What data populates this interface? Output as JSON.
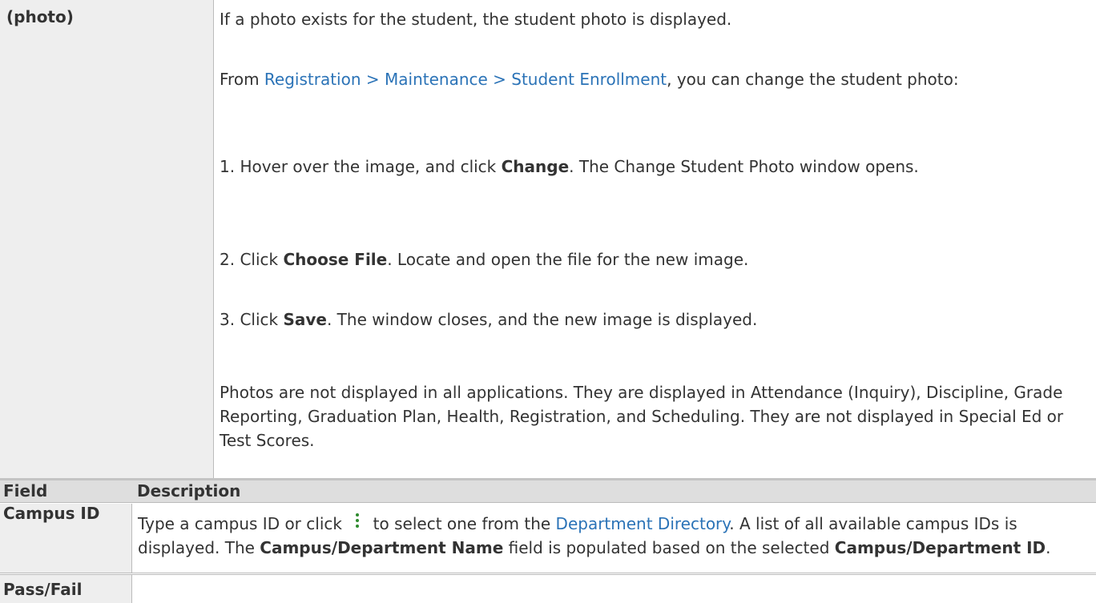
{
  "top_table": {
    "label": "(photo)",
    "p1": "If a photo exists for the student, the student photo is displayed.",
    "p2_pre": "From ",
    "p2_link": "Registration > Maintenance > Student Enrollment",
    "p2_post": ", you can change the student photo:",
    "step1_pre": "1. Hover over the image, and click ",
    "step1_bold": "Change",
    "step1_post": ". The Change Student Photo window opens.",
    "step2_pre": "2. Click ",
    "step2_bold": "Choose File",
    "step2_post": ". Locate and open the file for the new image.",
    "step3_pre": "3. Click ",
    "step3_bold": "Save",
    "step3_post": ". The window closes, and the new image is displayed.",
    "p_last": "Photos are not displayed in all applications. They are displayed in Attendance (Inquiry), Discipline, Grade Reporting, Graduation Plan, Health, Registration, and Scheduling. They are not displayed in Special Ed or Test Scores."
  },
  "field_table": {
    "header_field": "Field",
    "header_desc": "Description",
    "rows": [
      {
        "field": "Campus ID",
        "d1": "Type a campus ID or click",
        "d2": "to select one from the",
        "link": "Department Directory",
        "d3": ". A list of all available campus IDs is displayed. The",
        "b1": "Campus/Department Name",
        "d4": "field is populated based on the selected",
        "b2": "Campus/Department ID",
        "d5": "."
      },
      {
        "field": "Pass/Fail"
      }
    ]
  },
  "icons": {
    "lookup": "vertical-ellipsis-icon"
  },
  "colors": {
    "link": "#2b73b7",
    "icon": "#2e8b2e"
  }
}
